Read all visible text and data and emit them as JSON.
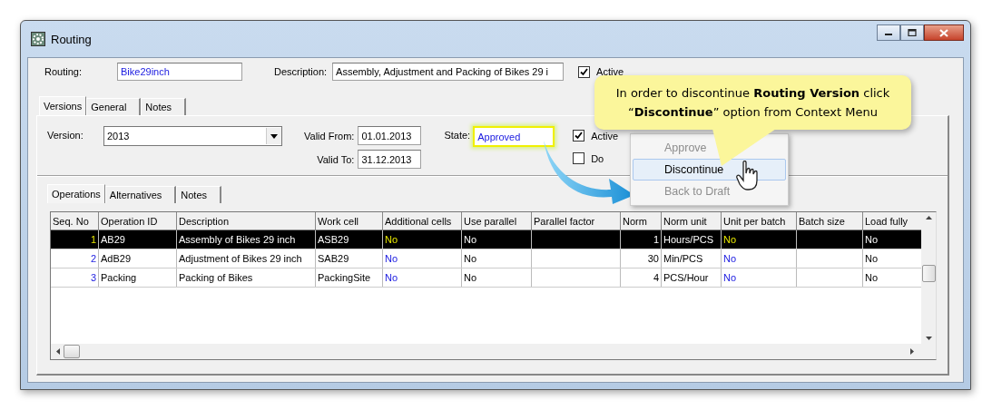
{
  "window": {
    "title": "Routing"
  },
  "header": {
    "routing_label": "Routing:",
    "routing_value": "Bike29inch",
    "description_label": "Description:",
    "description_value": "Assembly, Adjustment and Packing of Bikes 29 i",
    "active": {
      "label": "Active",
      "checked": true
    }
  },
  "tabs": [
    {
      "label": "Versions",
      "selected": true
    },
    {
      "label": "General",
      "selected": false
    },
    {
      "label": "Notes",
      "selected": false
    }
  ],
  "version_panel": {
    "version_label": "Version:",
    "version_value": "2013",
    "valid_from_label": "Valid From:",
    "valid_from_value": "01.01.2013",
    "valid_to_label": "Valid To:",
    "valid_to_value": "31.12.2013",
    "state_label": "State:",
    "state_value": "Approved",
    "state_highlighted": true,
    "active": {
      "label": "Active",
      "checked": true
    },
    "second_checkbox": {
      "label": "Do",
      "checked": false
    }
  },
  "inner_tabs": [
    {
      "label": "Operations",
      "selected": true
    },
    {
      "label": "Alternatives",
      "selected": false
    },
    {
      "label": "Notes",
      "selected": false
    }
  ],
  "table": {
    "columns": [
      {
        "label": "Seq. No",
        "kind": "link"
      },
      {
        "label": "Operation ID",
        "kind": "text"
      },
      {
        "label": "Description",
        "kind": "text"
      },
      {
        "label": "Work cell",
        "kind": "text"
      },
      {
        "label": "Additional cells",
        "kind": "link"
      },
      {
        "label": "Use parallel",
        "kind": "text"
      },
      {
        "label": "Parallel factor",
        "kind": "text"
      },
      {
        "label": "Norm",
        "kind": "number"
      },
      {
        "label": "Norm unit",
        "kind": "text"
      },
      {
        "label": "Unit per batch",
        "kind": "link"
      },
      {
        "label": "Batch size",
        "kind": "text"
      },
      {
        "label": "Load fully",
        "kind": "text"
      }
    ],
    "rows": [
      {
        "selected": true,
        "cells": [
          "1",
          "AB29",
          "Assembly of Bikes 29 inch",
          "ASB29",
          "No",
          "No",
          null,
          "1",
          "Hours/PCS",
          "No",
          null,
          "No"
        ]
      },
      {
        "selected": false,
        "cells": [
          "2",
          "AdB29",
          "Adjustment of Bikes 29 inch",
          "SAB29",
          "No",
          "No",
          null,
          "30",
          "Min/PCS",
          "No",
          null,
          "No"
        ]
      },
      {
        "selected": false,
        "cells": [
          "3",
          "Packing",
          "Packing of Bikes",
          "PackingSite",
          "No",
          "No",
          null,
          "4",
          "PCS/Hour",
          "No",
          null,
          "No"
        ]
      }
    ]
  },
  "context_menu": [
    {
      "label": "Approve",
      "disabled": true,
      "selected": false
    },
    {
      "label": "Discontinue",
      "disabled": false,
      "selected": true
    },
    {
      "label": "Back to Draft",
      "disabled": true,
      "selected": false
    }
  ],
  "callout": {
    "text": "In order to discontinue **Routing Version** click “**Discontinue**” option from Context Menu"
  }
}
